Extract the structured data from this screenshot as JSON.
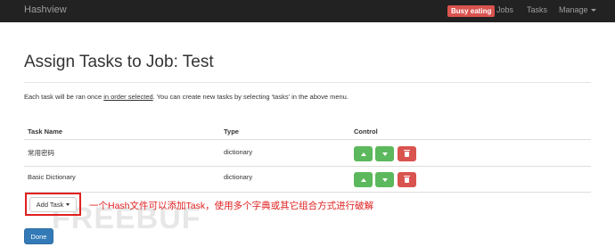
{
  "navbar": {
    "brand": "Hashview",
    "status_badge": "Busy eating",
    "items": [
      "Jobs",
      "Tasks",
      "Manage"
    ]
  },
  "page": {
    "title": "Assign Tasks to Job: Test",
    "description_before": "Each task will be ran once ",
    "description_link": "in order selected",
    "description_after": ". You can create new tasks by selecting 'tasks' in the above menu."
  },
  "table": {
    "headers": [
      "Task Name",
      "Type",
      "Control"
    ],
    "rows": [
      {
        "name": "常用密码",
        "type": "dictionary"
      },
      {
        "name": "Basic Dictionary",
        "type": "dictionary"
      }
    ]
  },
  "actions": {
    "add_task_label": "Add Task",
    "done_label": "Done"
  },
  "annotation": "一个Hash文件可以添加Task，使用多个字典或其它组合方式进行破解",
  "watermark": "FREEBUF",
  "icons": {
    "move_up": "chevron-up-icon",
    "move_down": "chevron-down-icon",
    "delete": "trash-icon"
  },
  "colors": {
    "navbar": "#222222",
    "badge": "#d9534f",
    "success": "#5cb85c",
    "danger": "#d9534f",
    "primary": "#337ab7",
    "annotation": "#e02020"
  }
}
